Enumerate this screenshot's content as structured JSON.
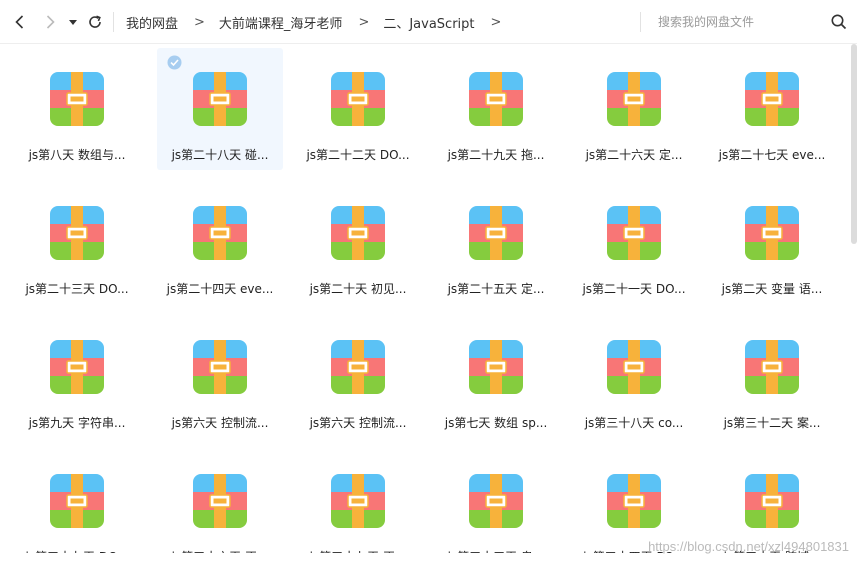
{
  "toolbar": {
    "breadcrumb": [
      "我的网盘",
      "大前端课程_海牙老师",
      "二、JavaScript"
    ],
    "crumb_separator": ">",
    "search_placeholder": "搜索我的网盘文件"
  },
  "files": [
    "js第八天 数组与...",
    "js第二十八天 碰...",
    "js第二十二天 DO...",
    "js第二十九天 拖...",
    "js第二十六天 定...",
    "js第二十七天 eve...",
    "js第二十三天 DO...",
    "js第二十四天 eve...",
    "js第二十天 初见...",
    "js第二十五天 定...",
    "js第二十一天 DO...",
    "js第二天 变量 语...",
    "js第九天 字符串...",
    "js第六天 控制流...",
    "js第六天 控制流...",
    "js第七天 数组 sp...",
    "js第三十八天 co...",
    "js第三十二天 案...",
    "js第三十九天 DO...",
    "js第三十六天 正...",
    "js第三十七天 正...",
    "js第三十三天 鬼...",
    "js第三十四天 BO...",
    "js第三十天 跨域..."
  ],
  "selected_index": 1,
  "colors": {
    "icon_blue": "#5bc2f5",
    "icon_red": "#f87676",
    "icon_green": "#85cc3e",
    "icon_strap": "#f7b23b",
    "selected_bg": "#f1f7fe",
    "check": "#a7cdf0"
  },
  "icons": {
    "back": "chevron-left-icon",
    "forward": "chevron-right-icon",
    "dropdown": "caret-down-icon",
    "refresh": "refresh-icon",
    "search": "search-icon",
    "file": "zip-archive-icon"
  },
  "watermark": "https://blog.csdn.net/xzl494801831"
}
